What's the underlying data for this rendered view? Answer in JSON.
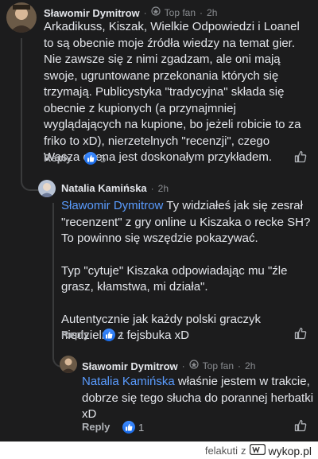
{
  "comments": [
    {
      "author": "Sławomir Dymitrow",
      "badge": "Top fan",
      "time": "2h",
      "text": "Arkadikuss, Kiszak, Wielkie Odpowiedzi i Loanel to są obecnie moje źródła wiedzy na temat gier. Nie zawsze się z nimi zgadzam, ale oni mają swoje, ugruntowane przekonania których się trzymają. Publicystyka \"tradycyjna\" składa się obecnie z kupionych (a przynajmniej wyglądających na kupione, bo jeżeli robicie to za friko to xD), nierzetelnych \"recenzji\", czego Wasza ocena jest doskonałym przykładem.",
      "reply_label": "Reply",
      "reaction_count": "5"
    },
    {
      "author": "Natalia Kamińska",
      "time": "2h",
      "mention": "Sławomir Dymitrow",
      "text_line1_rest": "Ty widziałeś jak się zesrał",
      "text_line2": "\"recenzent\" z gry online u Kiszaka o recke SH?",
      "text_line3": "To powinno się wszędzie pokazywać.",
      "text_para2": "Typ \"cytuje\" Kiszaka odpowiadając mu \"źle grasz, kłamstwa, mi działa\".",
      "text_para3": "Autentycznie jak każdy polski graczyk niedzielny z fejsbuka xD",
      "reply_label": "Reply",
      "reaction_count": "1"
    },
    {
      "author": "Sławomir Dymitrow",
      "badge": "Top fan",
      "time": "2h",
      "mention": "Natalia Kamińska",
      "text_line1_rest": "właśnie jestem w trakcie,",
      "text_line2": "dobrze się tego słucha do porannej herbatki",
      "text_line3": "xD",
      "reply_label": "Reply",
      "reaction_count": "1"
    }
  ],
  "footer": {
    "username": "felakuti",
    "separator": "z",
    "brand": "wykop.pl"
  }
}
